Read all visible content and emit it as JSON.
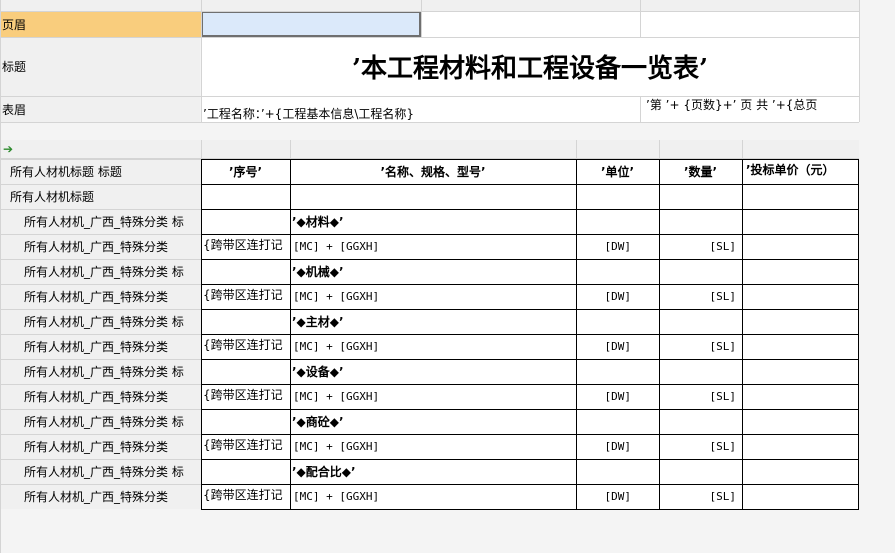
{
  "bands": {
    "page_header": "页眉",
    "title": "标题",
    "table_header": "表眉",
    "column_header_band": "所有人材机标题 标题",
    "group_band": "所有人材机标题"
  },
  "report": {
    "title": "’本工程材料和工程设备一览表’",
    "project_name_expr": "’工程名称：’+{工程基本信息\\工程名称}",
    "page_expr": "’第 ’+  {页数}+’ 页  共 ’+{总页"
  },
  "columns": [
    "’序号’",
    "’名称、规格、型号’",
    "’单位’",
    "’数量’",
    "’投标单价（元）"
  ],
  "category_label": "所有人材机_广西_特殊分类 标",
  "detail_label": "所有人材机_广西_特殊分类",
  "categories": [
    "’◆材料◆’",
    "’◆机械◆’",
    "’◆主材◆’",
    "’◆设备◆’",
    "’◆商砼◆’",
    "’◆配合比◆’"
  ],
  "detail": {
    "seq": "{跨带区连打记",
    "name": "[MC] + [GGXH]",
    "unit": "[DW]",
    "qty": "[SL]"
  }
}
